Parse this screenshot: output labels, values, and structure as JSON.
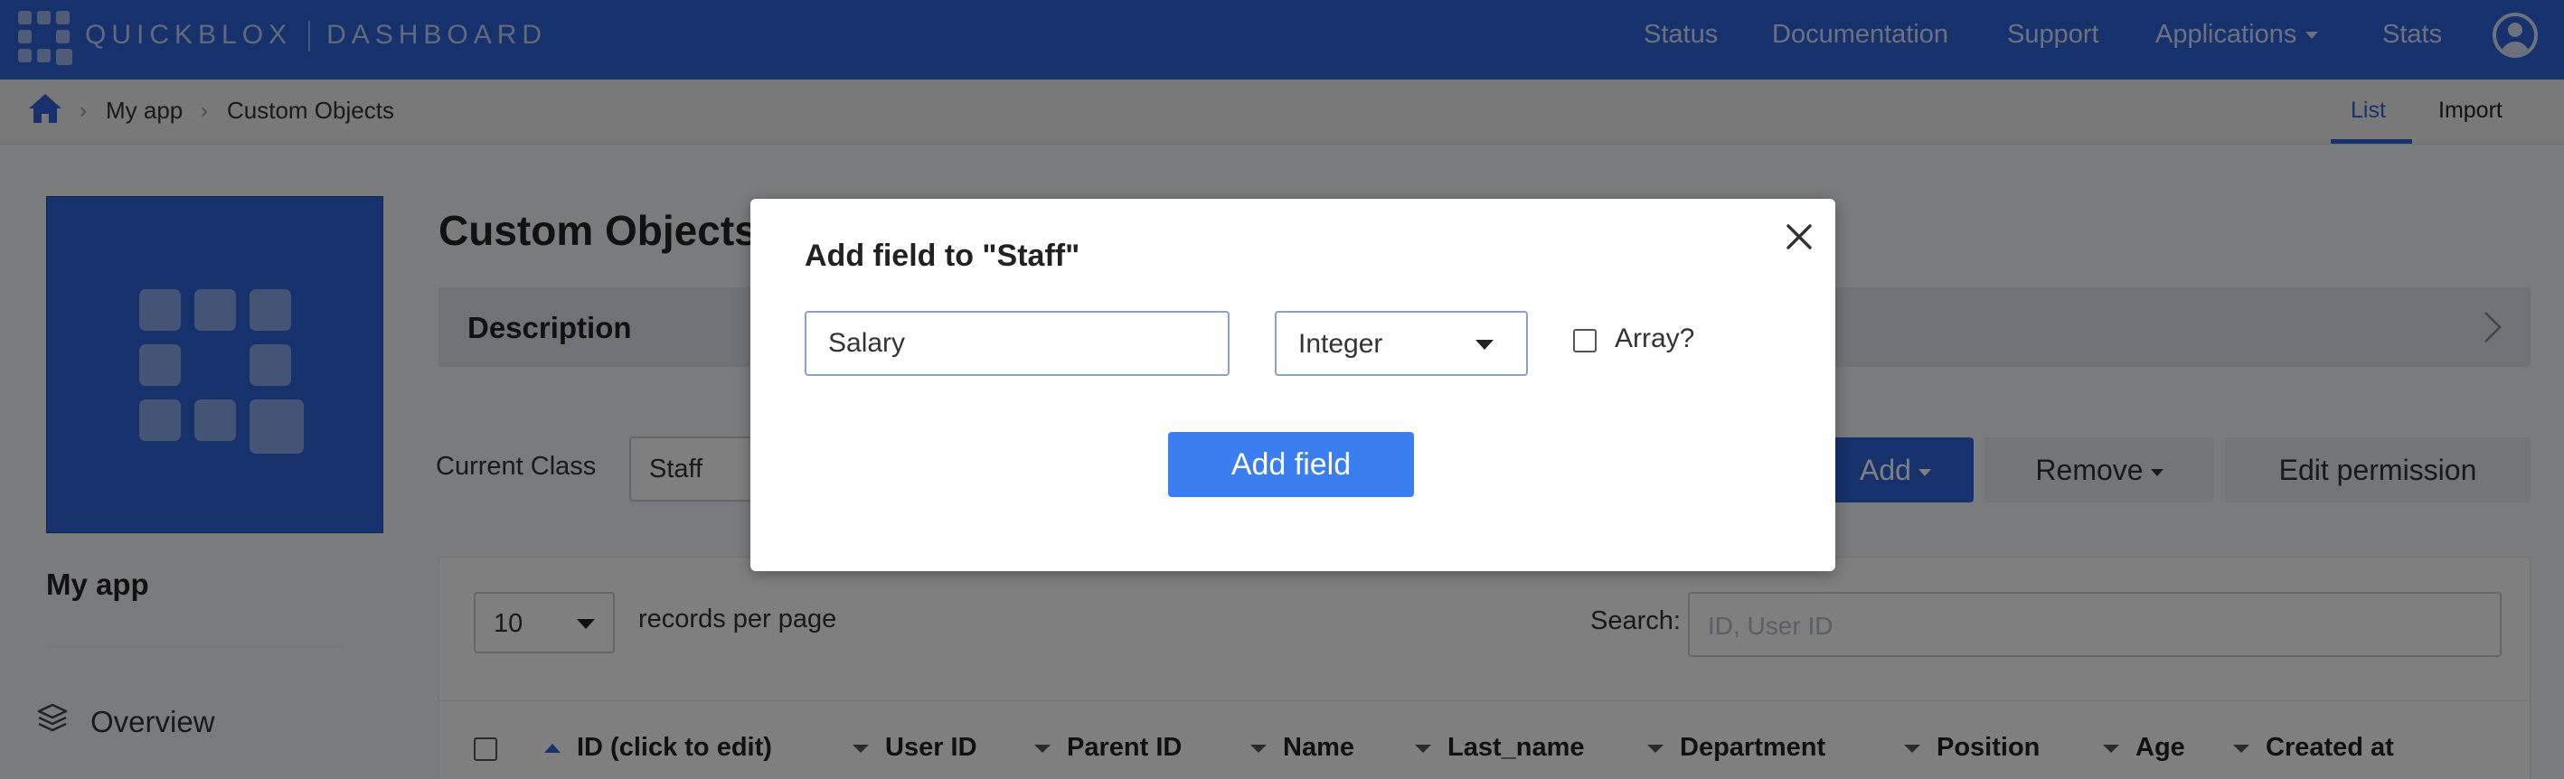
{
  "topbar": {
    "brand": "QUICKBLOX",
    "product": "DASHBOARD",
    "nav": {
      "status": "Status",
      "documentation": "Documentation",
      "support": "Support",
      "applications": "Applications",
      "stats": "Stats"
    },
    "accent_color": "#2e62d9"
  },
  "breadcrumb": {
    "items": [
      "My app",
      "Custom Objects"
    ]
  },
  "tabs": {
    "list": "List",
    "import": "Import",
    "active": "List"
  },
  "sidebar": {
    "app_name": "My app",
    "items": [
      {
        "label": "Overview",
        "icon": "layers-icon"
      }
    ]
  },
  "main": {
    "title": "Custom Objects",
    "description_label": "Description",
    "current_class_label": "Current Class",
    "current_class_value": "Staff",
    "buttons": {
      "add": "Add",
      "remove": "Remove",
      "edit_permission": "Edit permission"
    },
    "table": {
      "per_page_value": "10",
      "per_page_label": "records per page",
      "search_label": "Search:",
      "search_placeholder": "ID, User ID",
      "columns": [
        "ID (click to edit)",
        "User ID",
        "Parent ID",
        "Name",
        "Last_name",
        "Department",
        "Position",
        "Age",
        "Created at"
      ]
    }
  },
  "modal": {
    "title": "Add field to \"Staff\"",
    "field_name_value": "Salary",
    "field_type_value": "Integer",
    "array_label": "Array?",
    "array_checked": false,
    "submit_label": "Add field"
  }
}
